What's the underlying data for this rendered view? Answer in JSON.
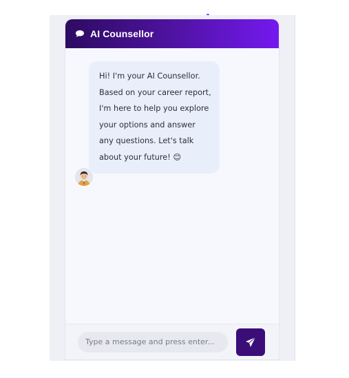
{
  "header": {
    "title": "AI Counsellor",
    "icon": "chat-bubble-icon"
  },
  "messages": [
    {
      "sender": "bot",
      "avatar": "counsellor-avatar",
      "text": "Hi! I'm your AI Counsellor. Based on your career report, I'm here to help you explore your options and answer any questions. Let's talk about your future! 😊"
    }
  ],
  "composer": {
    "placeholder": "Type a message and press enter...",
    "value": "",
    "send_icon": "paper-plane-icon"
  },
  "colors": {
    "header_gradient_start": "#2d0b62",
    "header_gradient_end": "#7419f0",
    "send_button": "#3a0d78",
    "bubble": "#e9eefb",
    "background": "#f7f8fd"
  }
}
